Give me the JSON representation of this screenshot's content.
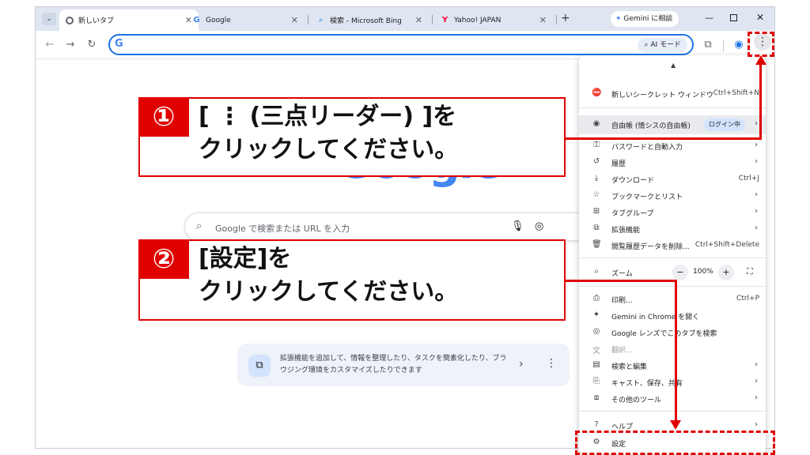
{
  "tabs": [
    {
      "title": "新しいタブ",
      "icon": "chrome-icon"
    },
    {
      "title": "Google",
      "icon": "google-icon"
    },
    {
      "title": "検索 - Microsoft Bing",
      "icon": "search-icon"
    },
    {
      "title": "Yahoo! JAPAN",
      "icon": "yahoo-icon"
    }
  ],
  "toolbar": {
    "gemini_label": "Gemini に相談",
    "ai_mode_label": "AI モード",
    "new_tab_plus": "+"
  },
  "ntp": {
    "search_placeholder": "Google で検索または URL を入力",
    "tile_text": "拡張機能を追加して、情報を整理したり、タスクを簡素化したり、ブラウジング環境をカスタマイズしたりできます"
  },
  "menu": {
    "items": [
      {
        "label": "新しいシークレット ウィンドウ",
        "shortcut": "Ctrl+Shift+N",
        "icon": "incognito-icon"
      },
      {
        "label": "自由帳 (情シスの自由帳)",
        "badge": "ログイン中",
        "icon": "profile-icon"
      },
      {
        "label": "パスワードと自動入力",
        "icon": "key-icon"
      },
      {
        "label": "履歴",
        "icon": "history-icon"
      },
      {
        "label": "ダウンロード",
        "shortcut": "Ctrl+J",
        "icon": "download-icon"
      },
      {
        "label": "ブックマークとリスト",
        "icon": "star-icon"
      },
      {
        "label": "タブグループ",
        "icon": "grid-icon"
      },
      {
        "label": "拡張機能",
        "icon": "puzzle-icon"
      },
      {
        "label": "閲覧履歴データを削除...",
        "shortcut": "Ctrl+Shift+Delete",
        "icon": "trash-icon"
      },
      {
        "label": "ズーム",
        "zoom": "100%",
        "icon": "zoom-icon"
      },
      {
        "label": "印刷...",
        "shortcut": "Ctrl+P",
        "icon": "print-icon"
      },
      {
        "label": "Gemini in Chrome を開く",
        "icon": "sparkle-icon"
      },
      {
        "label": "Google レンズでこのタブを検索",
        "icon": "lens-icon"
      },
      {
        "label": "翻訳...",
        "icon": "translate-icon"
      },
      {
        "label": "検索と編集",
        "icon": "search-edit-icon"
      },
      {
        "label": "キャスト、保存、共有",
        "icon": "cast-icon"
      },
      {
        "label": "その他のツール",
        "icon": "toolbox-icon"
      },
      {
        "label": "ヘルプ",
        "icon": "help-icon"
      },
      {
        "label": "設定",
        "icon": "gear-icon"
      }
    ]
  },
  "callouts": [
    {
      "number": "①",
      "line1": "[ ⋮ (三点リーダー) ]を",
      "line2": "クリックしてください。"
    },
    {
      "number": "②",
      "line1": "[設定]を",
      "line2": "クリックしてください。"
    }
  ],
  "colors": {
    "accent": "#1a73e8",
    "highlight": "#e00000"
  }
}
